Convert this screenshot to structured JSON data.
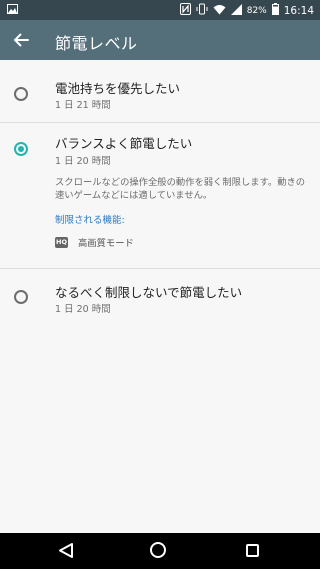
{
  "status_bar": {
    "battery_percent": "82%",
    "time": "16:14",
    "icons": [
      "image-icon",
      "nfc-icon",
      "vibrate-icon",
      "wifi-icon",
      "signal-icon",
      "battery-icon"
    ]
  },
  "app_bar": {
    "title": "節電レベル",
    "back_icon": "arrow-left-icon"
  },
  "options": [
    {
      "title": "電池持ちを優先したい",
      "subtitle": "1 日 21 時間",
      "selected": false
    },
    {
      "title": "バランスよく節電したい",
      "subtitle": "1 日 20 時間",
      "selected": true,
      "description": "スクロールなどの操作全般の動作を弱く制限します。動きの速いゲームなどには適していません。",
      "restricted_label": "制限される機能:",
      "features": [
        {
          "icon_text": "HQ",
          "icon": "hq-icon",
          "label": "高画質モード"
        }
      ]
    },
    {
      "title": "なるべく制限しないで節電したい",
      "subtitle": "1 日 20 時間",
      "selected": false
    }
  ],
  "nav_bar": {
    "icons": [
      "back-triangle-icon",
      "home-circle-icon",
      "recent-square-icon"
    ]
  },
  "colors": {
    "status_bar": "#37474f",
    "app_bar": "#546e7a",
    "accent": "#20b6b0",
    "link": "#2a7ac5"
  }
}
